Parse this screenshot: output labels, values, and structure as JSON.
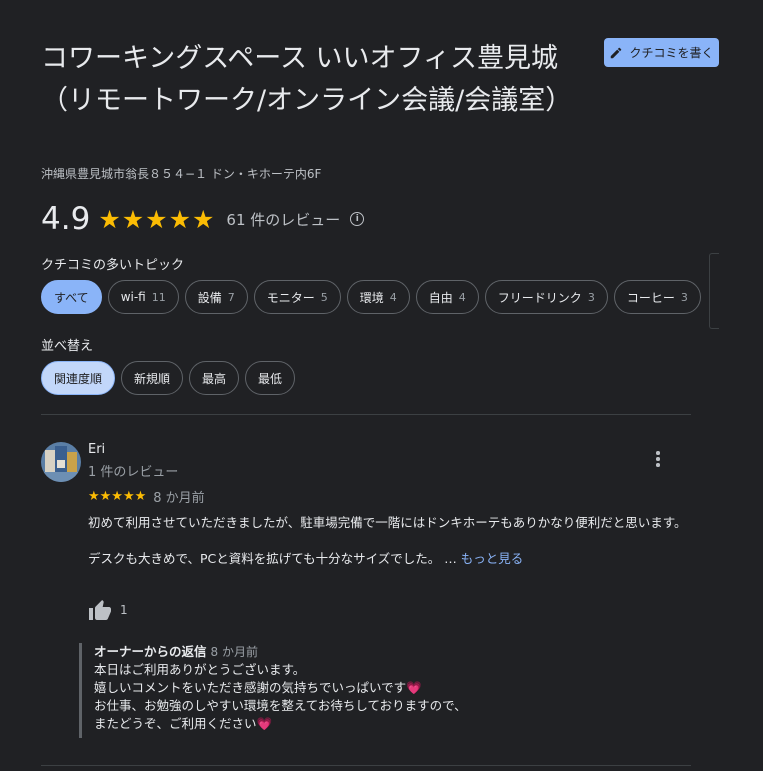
{
  "place": {
    "title": "コワーキングスペース いいオフィス豊見城（リモートワーク/オンライン会議/会議室）",
    "address": "沖縄県豊見城市翁長８５４−１ ドン・キホーテ内6F",
    "write_review_label": "クチコミを書く"
  },
  "rating": {
    "value": "4.9",
    "stars": 5,
    "count_label": "61 件のレビュー"
  },
  "topics": {
    "label": "クチコミの多いトピック",
    "chips": [
      {
        "label": "すべて",
        "count": ""
      },
      {
        "label": "wi-fi",
        "count": "11"
      },
      {
        "label": "設備",
        "count": "7"
      },
      {
        "label": "モニター",
        "count": "5"
      },
      {
        "label": "環境",
        "count": "4"
      },
      {
        "label": "自由",
        "count": "4"
      },
      {
        "label": "フリードリンク",
        "count": "3"
      },
      {
        "label": "コーヒー",
        "count": "3"
      }
    ]
  },
  "sort": {
    "label": "並べ替え",
    "options": [
      "関連度順",
      "新規順",
      "最高",
      "最低"
    ]
  },
  "review": {
    "name": "Eri",
    "sub": "1 件のレビュー",
    "stars": "★★★★★",
    "date": "8 か月前",
    "text_1": "初めて利用させていただきましたが、駐車場完備で一階にはドンキホーテもありかなり便利だと思います。",
    "text_2": "デスクも大きめで、PCと資料を拡げても十分なサイズでした。 …",
    "more_label": "もっと見る",
    "likes": "1"
  },
  "owner_reply": {
    "heading": "オーナーからの返信",
    "date": "8 か月前",
    "line_1": "本日はご利用ありがとうございます。",
    "line_2": "嬉しいコメントをいただき感謝の気持ちでいっぱいです",
    "line_3": "お仕事、お勉強のしやすい環境を整えてお待ちしておりますので、",
    "line_4": "またどうぞ、ご利用ください",
    "heart": "💗"
  },
  "colors": {
    "background": "#202124",
    "accent": "#8ab4f8",
    "star": "#fbbc04"
  }
}
